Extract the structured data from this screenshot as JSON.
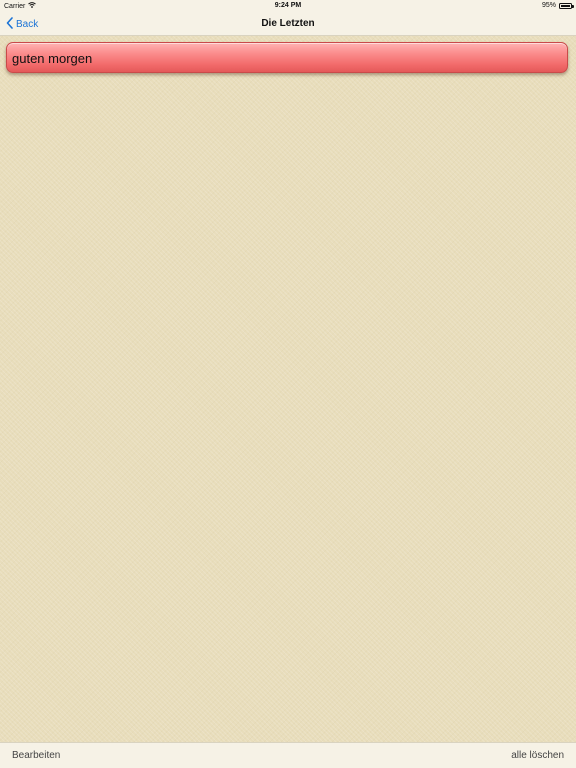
{
  "status_bar": {
    "carrier": "Carrier",
    "time": "9:24 PM",
    "battery_text": "95%",
    "battery_level": 0.95,
    "wifi_icon": "wifi-icon",
    "battery_icon": "battery-icon"
  },
  "nav": {
    "back_label": "Back",
    "back_icon": "chevron-left-icon",
    "title": "Die Letzten"
  },
  "list": {
    "items": [
      {
        "label": "guten morgen"
      }
    ]
  },
  "toolbar": {
    "edit_label": "Bearbeiten",
    "delete_all_label": "alle löschen"
  },
  "colors": {
    "accent": "#1a73d6",
    "item_fill": "#f26a6a",
    "background": "#e8ddbb"
  }
}
